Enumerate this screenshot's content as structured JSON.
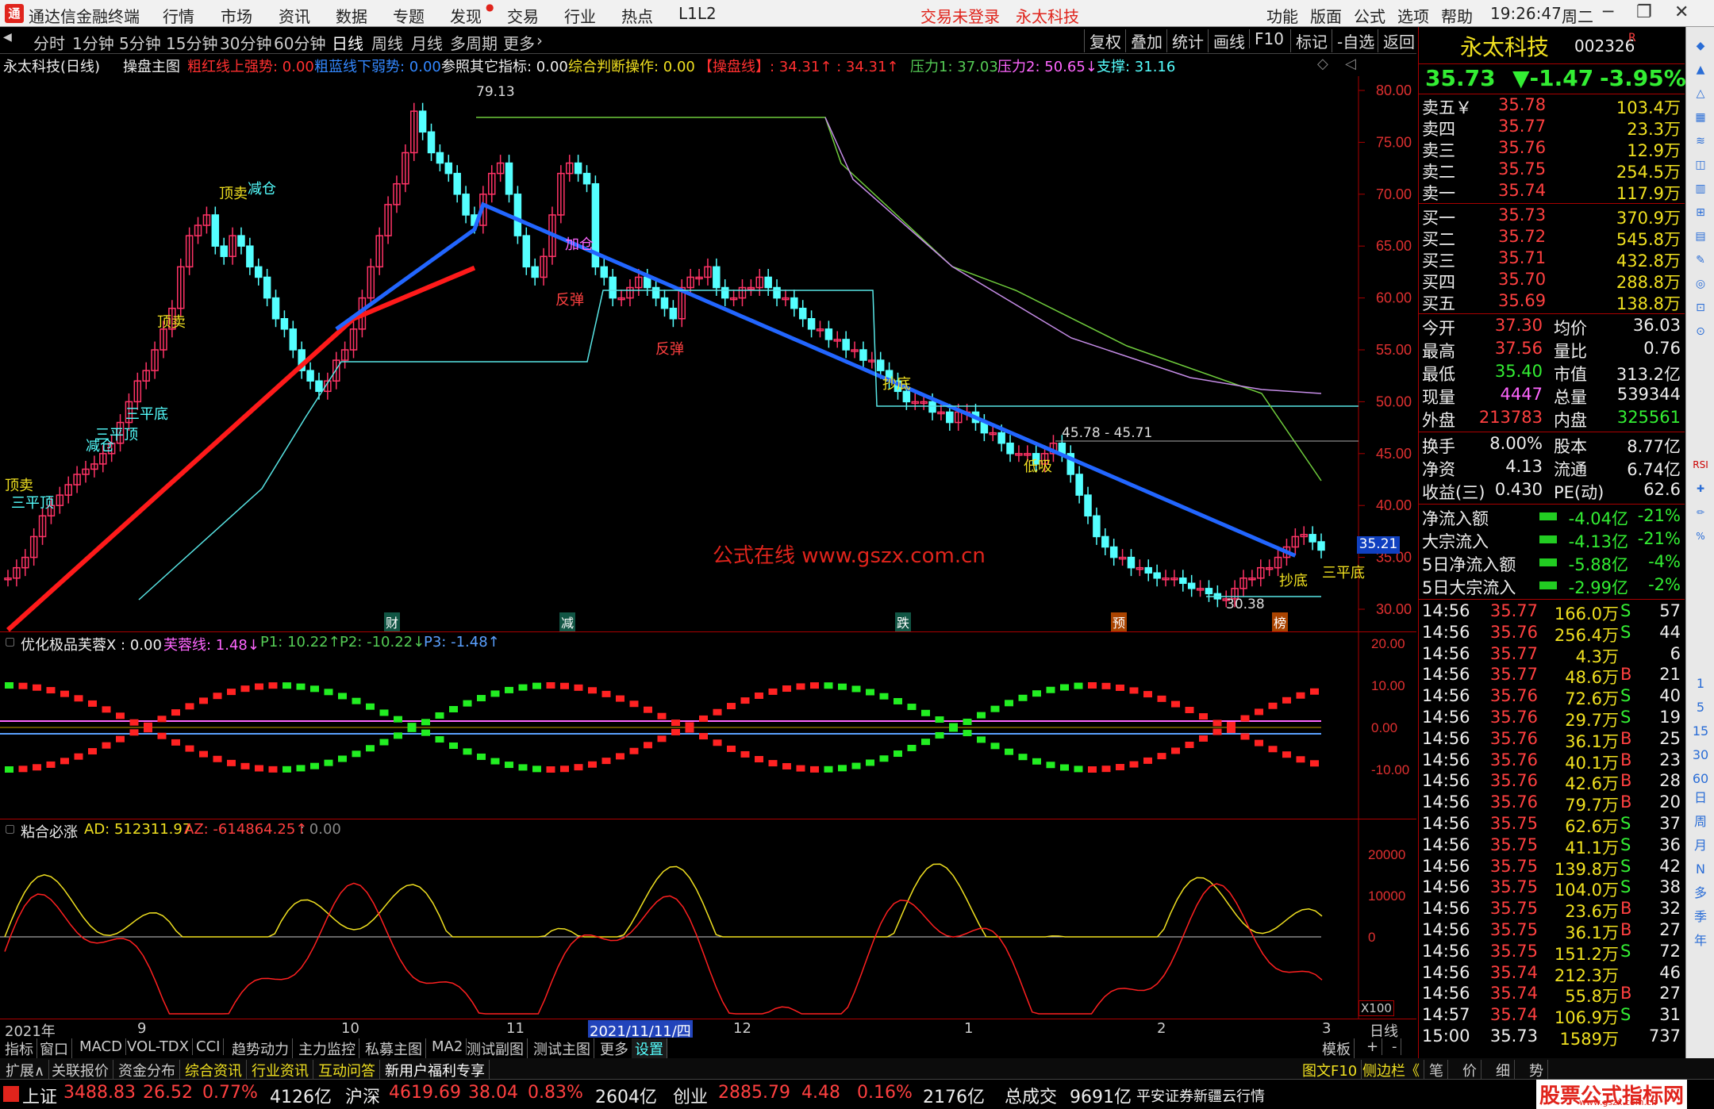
{
  "app": {
    "name": "通达信金融终端",
    "menus": [
      "行情",
      "市场",
      "资讯",
      "数据",
      "专题",
      "发现",
      "交易",
      "行业",
      "热点",
      "L1L2"
    ],
    "login": "交易未登录",
    "stock_title": "永太科技",
    "right_menus": [
      "功能",
      "版面",
      "公式",
      "选项",
      "帮助"
    ],
    "clock": "19:26:47",
    "weekday": "周二"
  },
  "toolbar": {
    "periods": [
      "分时",
      "1分钟",
      "5分钟",
      "15分钟",
      "30分钟",
      "60分钟",
      "日线",
      "周线",
      "月线",
      "多周期",
      "更多"
    ],
    "active": "日线",
    "right": [
      "复权",
      "叠加",
      "统计",
      "画线",
      "F10",
      "标记",
      "-自选",
      "返回"
    ]
  },
  "info": {
    "stock": "永太科技(日线)",
    "chart": "操盘主图",
    "l1": "粗红线上强势: 0.00",
    "l2": "粗蓝线下弱势: 0.00",
    "l3": "参照其它指标: 0.00",
    "l4": "综合判断操作: 0.00",
    "l5": "【操盘线】: 34.31↑ : 34.31↑",
    "p1": "压力1: 37.03",
    "p2": "压力2: 50.65↓",
    "sup": "支撑: 31.16"
  },
  "axis": {
    "price_ticks": [
      "80.00",
      "75.00",
      "70.00",
      "65.00",
      "60.00",
      "55.00",
      "50.00",
      "45.00",
      "40.00",
      "35.00",
      "30.00"
    ],
    "price_label": "35.21",
    "ind1_ticks": [
      "20.00",
      "10.00",
      "0.00",
      "-10.00"
    ],
    "ind2_ticks": [
      "20000",
      "10000",
      "0"
    ],
    "ind2_unit": "X100"
  },
  "chart_labels": {
    "watermark": "公式在线  www.gszx.com.cn",
    "hi": "79.13",
    "lo": "30.38",
    "range": "45.78 - 45.71",
    "events": [
      "财",
      "减",
      "跌",
      "预",
      "榜"
    ],
    "signals": [
      "顶卖",
      "三平顶",
      "减仓",
      "顶卖",
      "三平顶",
      "顶卖",
      "加仓",
      "反弹",
      "反弹",
      "抄底",
      "三平底",
      "抄底",
      "三平底",
      "低吸",
      "减仓"
    ]
  },
  "ind1": {
    "name": "优化极品芙蓉X : 0.00",
    "f": "芙蓉线: 1.48↓",
    "p1": "P1: 10.22↑",
    "p2": "P2: -10.22↓",
    "p3": "P3: -1.48↑"
  },
  "ind2": {
    "name": "粘合必涨",
    "ad": "AD: 512311.97",
    "az": "AZ: -614864.25↑",
    "z": ": 0.00"
  },
  "dates": [
    "2021年",
    "9",
    "10",
    "11",
    "2021/11/11/四",
    "12",
    "1",
    "2",
    "3"
  ],
  "date_right": "日线",
  "tabs": [
    "指标",
    "窗口",
    "MACD",
    "VOL-TDX",
    "CCI",
    "趋势动力",
    "主力监控",
    "私募主图",
    "MA2",
    "测试副图",
    "测试主图",
    "更多",
    "设置"
  ],
  "tab_right": [
    "模板",
    "+",
    "-"
  ],
  "ext": [
    "扩展∧",
    "关联报价",
    "资金分布",
    "综合资讯",
    "行业资讯",
    "互动问答",
    "新用户福利专享"
  ],
  "ext_right": [
    "图文F10",
    "侧边栏《",
    "笔",
    "价",
    "细",
    "势"
  ],
  "status": {
    "idx1": "上证",
    "v1": "3488.83",
    "c1": "26.52",
    "p1": "0.77%",
    "a1": "4126亿",
    "idx2": "沪深",
    "v2": "4619.69",
    "c2": "38.04",
    "p2": "0.83%",
    "a2": "2604亿",
    "idx3": "创业",
    "v3": "2885.79",
    "c3": "4.48",
    "p3": "0.16%",
    "a3": "2176亿",
    "tot": "总成交",
    "tv": "9691亿",
    "broker": "平安证券新疆云行情",
    "brand": "股票公式指标网",
    "url": "www.gszx.com.cn"
  },
  "quote": {
    "name": "永太科技",
    "code": "002326",
    "flag": "R",
    "price": "35.73",
    "change": "▼-1.47",
    "pct": "-3.95%",
    "asks": [
      [
        "卖五￥",
        "35.78",
        "103.4万"
      ],
      [
        "卖四",
        "35.77",
        "23.3万"
      ],
      [
        "卖三",
        "35.76",
        "12.9万"
      ],
      [
        "卖二",
        "35.75",
        "254.5万"
      ],
      [
        "卖一",
        "35.74",
        "117.9万"
      ]
    ],
    "bids": [
      [
        "买一",
        "35.73",
        "370.9万"
      ],
      [
        "买二",
        "35.72",
        "545.8万"
      ],
      [
        "买三",
        "35.71",
        "432.8万"
      ],
      [
        "买四",
        "35.70",
        "288.8万"
      ],
      [
        "买五",
        "35.69",
        "138.8万"
      ]
    ],
    "stats": [
      [
        "今开",
        "37.30",
        "均价",
        "36.03"
      ],
      [
        "最高",
        "37.56",
        "量比",
        "0.76"
      ],
      [
        "最低",
        "35.40",
        "市值",
        "313.2亿"
      ],
      [
        "现量",
        "4447",
        "总量",
        "539344"
      ],
      [
        "外盘",
        "213783",
        "内盘",
        "325561"
      ]
    ],
    "fin": [
      [
        "换手",
        "8.00%",
        "股本",
        "8.77亿"
      ],
      [
        "净资",
        "4.13",
        "流通",
        "6.74亿"
      ],
      [
        "收益(三)",
        "0.430",
        "PE(动)",
        "62.6"
      ]
    ],
    "flows": [
      [
        "净流入额",
        "-4.04亿",
        "-21%"
      ],
      [
        "大宗流入",
        "-4.13亿",
        "-21%"
      ],
      [
        "5日净流入额",
        "-5.88亿",
        "-4%"
      ],
      [
        "5日大宗流入",
        "-2.99亿",
        "-2%"
      ]
    ],
    "ticks": [
      [
        "14:56",
        "35.77",
        "166.0万",
        "S",
        "57"
      ],
      [
        "14:56",
        "35.76",
        "256.4万",
        "S",
        "44"
      ],
      [
        "14:56",
        "35.77",
        "4.3万",
        "",
        "6"
      ],
      [
        "14:56",
        "35.77",
        "48.6万",
        "B",
        "21"
      ],
      [
        "14:56",
        "35.76",
        "72.6万",
        "S",
        "40"
      ],
      [
        "14:56",
        "35.76",
        "29.7万",
        "S",
        "19"
      ],
      [
        "14:56",
        "35.76",
        "36.1万",
        "B",
        "25"
      ],
      [
        "14:56",
        "35.76",
        "40.1万",
        "B",
        "23"
      ],
      [
        "14:56",
        "35.76",
        "42.6万",
        "B",
        "28"
      ],
      [
        "14:56",
        "35.76",
        "79.7万",
        "B",
        "20"
      ],
      [
        "14:56",
        "35.75",
        "62.6万",
        "S",
        "37"
      ],
      [
        "14:56",
        "35.75",
        "41.1万",
        "S",
        "36"
      ],
      [
        "14:56",
        "35.75",
        "139.8万",
        "S",
        "42"
      ],
      [
        "14:56",
        "35.75",
        "104.0万",
        "S",
        "38"
      ],
      [
        "14:56",
        "35.75",
        "23.6万",
        "B",
        "32"
      ],
      [
        "14:56",
        "35.75",
        "36.1万",
        "B",
        "27"
      ],
      [
        "14:56",
        "35.75",
        "151.2万",
        "S",
        "72"
      ],
      [
        "14:56",
        "35.74",
        "212.3万",
        "",
        "46"
      ],
      [
        "14:56",
        "35.74",
        "55.8万",
        "B",
        "27"
      ],
      [
        "14:57",
        "35.74",
        "106.9万",
        "S",
        "31"
      ],
      [
        "15:00",
        "35.73",
        "1589万",
        "",
        "737"
      ]
    ]
  },
  "side": [
    "日",
    "周",
    "月",
    "N",
    "多",
    "季",
    "年"
  ],
  "side_nums": [
    "1",
    "5",
    "15",
    "30",
    "60"
  ]
}
